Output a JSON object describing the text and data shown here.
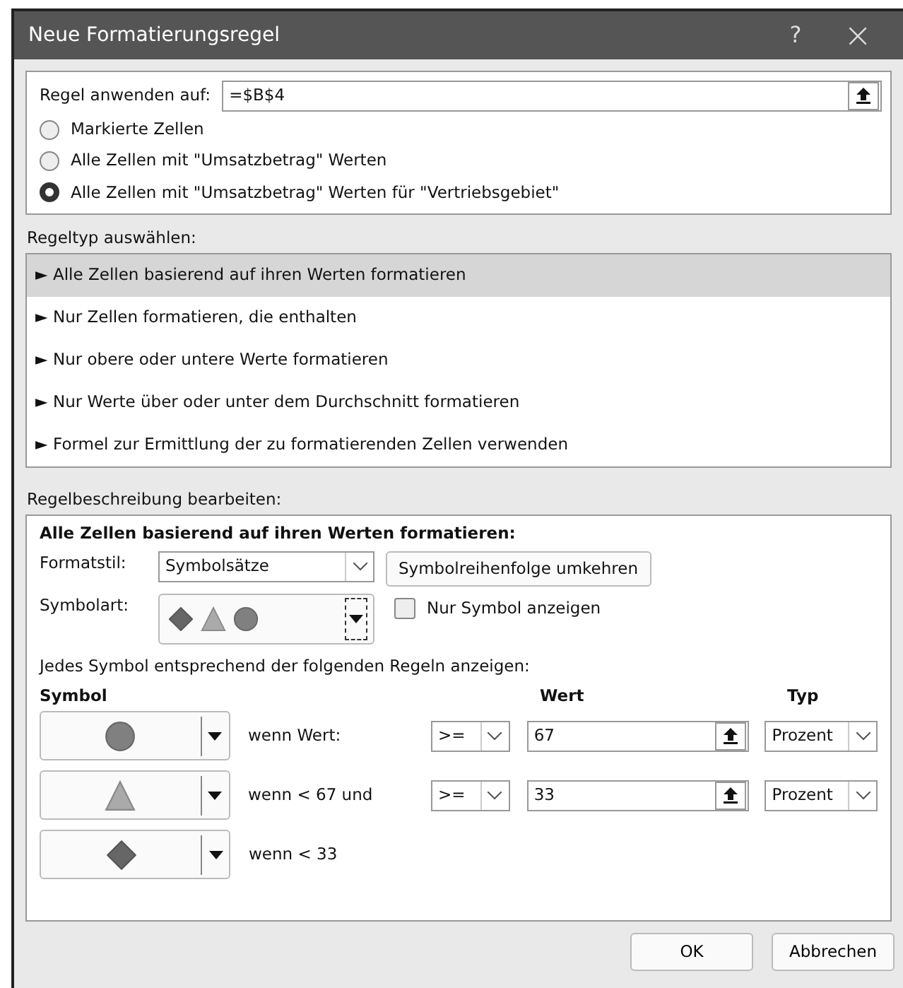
{
  "window": {
    "title": "Neue Formatierungsregel",
    "help": "?",
    "close": "×"
  },
  "apply_to": {
    "label": "Regel anwenden auf:",
    "value": "=$B$4"
  },
  "scope_options": [
    {
      "label": "Markierte Zellen",
      "selected": false
    },
    {
      "label": "Alle Zellen mit \"Umsatzbetrag\" Werten",
      "selected": false
    },
    {
      "label": "Alle Zellen mit \"Umsatzbetrag\" Werten für \"Vertriebsgebiet\"",
      "selected": true
    }
  ],
  "rule_type": {
    "label": "Regeltyp auswählen:",
    "items": [
      {
        "label": "► Alle Zellen basierend auf ihren Werten formatieren",
        "selected": true
      },
      {
        "label": "► Nur Zellen formatieren, die enthalten",
        "selected": false
      },
      {
        "label": "► Nur obere oder untere Werte formatieren",
        "selected": false
      },
      {
        "label": "► Nur Werte über oder unter dem Durchschnitt formatieren",
        "selected": false
      },
      {
        "label": "► Formel zur Ermittlung der zu formatierenden Zellen verwenden",
        "selected": false
      }
    ]
  },
  "description": {
    "label": "Regelbeschreibung bearbeiten:",
    "heading": "Alle Zellen basierend auf ihren Werten formatieren:",
    "format_style": {
      "label": "Formatstil:",
      "value": "Symbolsätze"
    },
    "reverse_button": {
      "label": "Symbolreihenfolge umkehren"
    },
    "icon_style": {
      "label": "Symbolart:",
      "symbols": [
        {
          "kind": "diamond"
        },
        {
          "kind": "triangle"
        },
        {
          "kind": "circle"
        }
      ]
    },
    "icon_only": {
      "label": "Nur Symbol anzeigen",
      "checked": false
    },
    "rules_intro": "Jedes Symbol entsprechend der folgenden Regeln anzeigen:",
    "columns": [
      {
        "label": "Symbol"
      },
      {
        "label": "Wert"
      },
      {
        "label": "Typ"
      }
    ],
    "rules": [
      {
        "kind": "circle",
        "condition": "wenn Wert:",
        "operator": ">=",
        "value": "67",
        "type": "Prozent"
      },
      {
        "kind": "triangle",
        "condition": "wenn < 67 und",
        "operator": ">=",
        "value": "33",
        "type": "Prozent"
      },
      {
        "kind": "diamond",
        "condition": "wenn < 33"
      }
    ]
  },
  "buttons": [
    "OK",
    "Abbrechen"
  ]
}
